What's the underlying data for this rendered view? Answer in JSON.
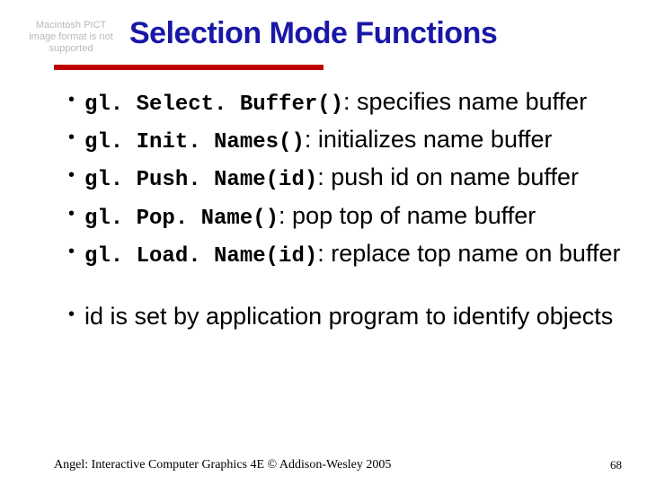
{
  "pict_placeholder": "Macintosh PICT image format is not supported",
  "title": "Selection Mode Functions",
  "bullets": [
    {
      "code": "gl. Select. Buffer()",
      "desc": ": specifies name buffer"
    },
    {
      "code": "gl. Init. Names()",
      "desc": ": initializes name buffer"
    },
    {
      "code": "gl. Push. Name(id)",
      "desc": ": push id on name buffer"
    },
    {
      "code": "gl. Pop. Name()",
      "desc": ": pop top of name buffer"
    },
    {
      "code": "gl. Load. Name(id)",
      "desc": ": replace top name on buffer"
    }
  ],
  "bullet_extra": "id is set by application program to identify objects",
  "copyright": "Angel: Interactive Computer Graphics 4E © Addison-Wesley 2005",
  "page_number": "68"
}
